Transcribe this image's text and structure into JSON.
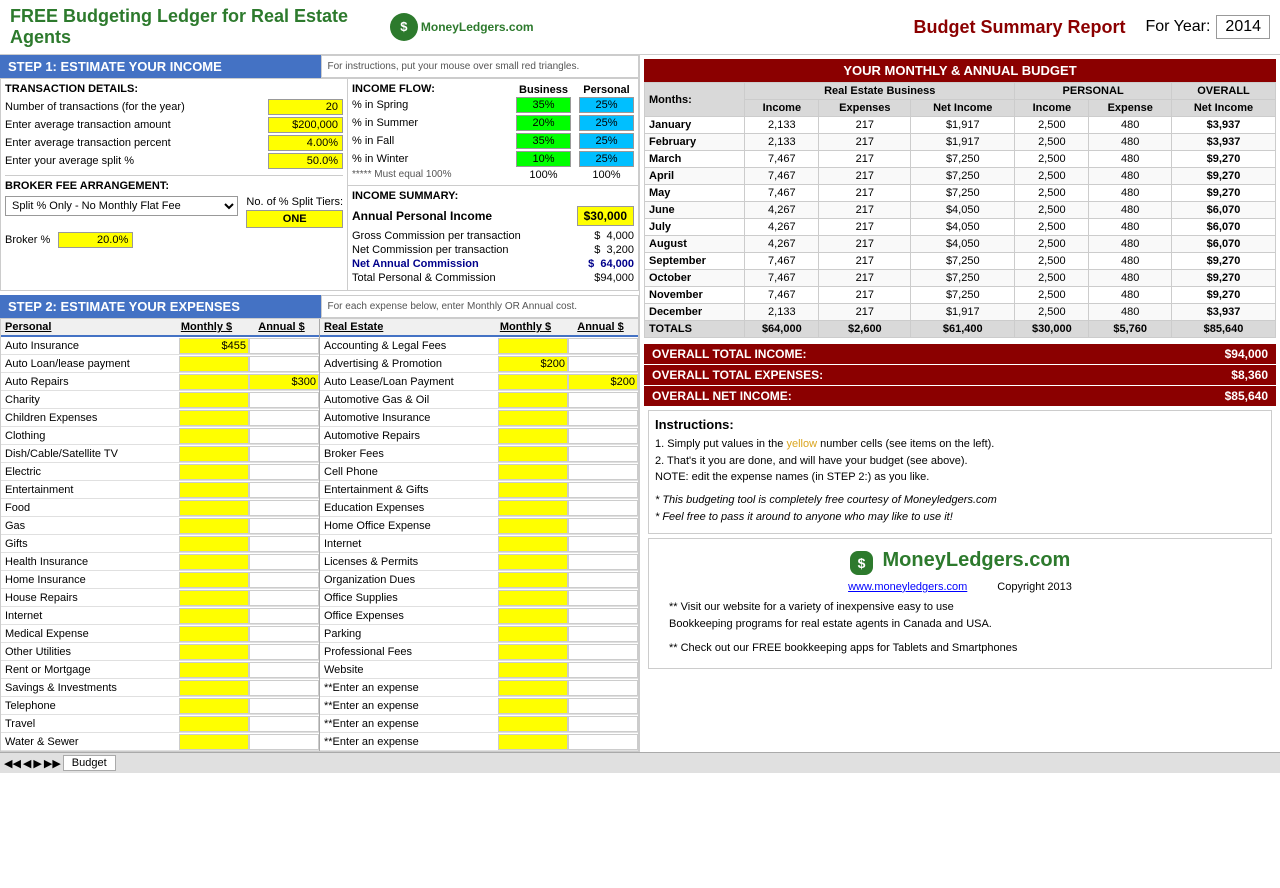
{
  "header": {
    "title": "FREE Budgeting Ledger for Real Estate Agents",
    "logo": "MoneyLedgers.com",
    "budget_summary": "Budget Summary Report",
    "for_year_label": "For Year:",
    "year": "2014"
  },
  "step1": {
    "label": "STEP 1:  ESTIMATE YOUR INCOME",
    "instructions": "For instructions, put your mouse over small red triangles.",
    "transaction_details": {
      "title": "TRANSACTION DETAILS:",
      "rows": [
        {
          "label": "Number of transactions (for the year)",
          "value": "20"
        },
        {
          "label": "Enter average transaction amount",
          "value": "$200,000"
        },
        {
          "label": "Enter average transaction percent",
          "value": "4.00%"
        },
        {
          "label": "Enter your average split %",
          "value": "50.0%"
        }
      ]
    },
    "income_flow": {
      "title": "INCOME FLOW:",
      "headers": [
        "Business",
        "Personal"
      ],
      "rows": [
        {
          "label": "% in Spring",
          "business": "35%",
          "personal": "25%"
        },
        {
          "label": "% in Summer",
          "business": "20%",
          "personal": "25%"
        },
        {
          "label": "% in Fall",
          "business": "35%",
          "personal": "25%"
        },
        {
          "label": "% in Winter",
          "business": "10%",
          "personal": "25%"
        }
      ],
      "must_equal": "***** Must equal 100%",
      "totals": [
        "100%",
        "100%"
      ]
    },
    "broker_fee": {
      "title": "BROKER FEE ARRANGEMENT:",
      "no_of_pct_split_tiers": "No. of % Split Tiers:",
      "dropdown_value": "Split % Only - No Monthly Flat Fee",
      "one_box": "ONE",
      "broker_pct_label": "Broker %",
      "broker_pct_value": "20.0%"
    },
    "income_summary": {
      "title": "INCOME SUMMARY:",
      "annual_personal_label": "Annual Personal Income",
      "annual_personal_value": "$30,000",
      "rows": [
        {
          "label": "Gross Commission per transaction",
          "prefix": "$",
          "value": "4,000"
        },
        {
          "label": "Net Commission per transaction",
          "prefix": "$",
          "value": "3,200"
        },
        {
          "label": "Net Annual Commission",
          "prefix": "$",
          "value": "64,000",
          "bold": true
        },
        {
          "label": "Total Personal & Commission",
          "prefix": "",
          "value": "$94,000"
        }
      ]
    }
  },
  "step2": {
    "label": "STEP 2: ESTIMATE YOUR EXPENSES",
    "instructions": "For each expense below, enter Monthly OR Annual cost.",
    "personal_header": "Personal",
    "monthly_header": "Monthly $",
    "annual_header": "Annual $",
    "real_estate_header": "Real Estate",
    "re_monthly_header": "Monthly $",
    "re_annual_header": "Annual $",
    "personal_expenses": [
      {
        "name": "Auto Insurance",
        "monthly": "$455",
        "annual": ""
      },
      {
        "name": "Auto Loan/lease payment",
        "monthly": "",
        "annual": ""
      },
      {
        "name": "Auto Repairs",
        "monthly": "",
        "annual": "$300"
      },
      {
        "name": "Charity",
        "monthly": "",
        "annual": ""
      },
      {
        "name": "Children Expenses",
        "monthly": "",
        "annual": ""
      },
      {
        "name": "Clothing",
        "monthly": "",
        "annual": ""
      },
      {
        "name": "Dish/Cable/Satellite TV",
        "monthly": "",
        "annual": ""
      },
      {
        "name": "Electric",
        "monthly": "",
        "annual": ""
      },
      {
        "name": "Entertainment",
        "monthly": "",
        "annual": ""
      },
      {
        "name": "Food",
        "monthly": "",
        "annual": ""
      },
      {
        "name": "Gas",
        "monthly": "",
        "annual": ""
      },
      {
        "name": "Gifts",
        "monthly": "",
        "annual": ""
      },
      {
        "name": "Health Insurance",
        "monthly": "",
        "annual": ""
      },
      {
        "name": "Home Insurance",
        "monthly": "",
        "annual": ""
      },
      {
        "name": "House Repairs",
        "monthly": "",
        "annual": ""
      },
      {
        "name": "Internet",
        "monthly": "",
        "annual": ""
      },
      {
        "name": "Medical Expense",
        "monthly": "",
        "annual": ""
      },
      {
        "name": "Other Utilities",
        "monthly": "",
        "annual": ""
      },
      {
        "name": "Rent or Mortgage",
        "monthly": "",
        "annual": ""
      },
      {
        "name": "Savings & Investments",
        "monthly": "",
        "annual": ""
      },
      {
        "name": "Telephone",
        "monthly": "",
        "annual": ""
      },
      {
        "name": "Travel",
        "monthly": "",
        "annual": ""
      },
      {
        "name": "Water & Sewer",
        "monthly": "",
        "annual": ""
      }
    ],
    "real_estate_expenses": [
      {
        "name": "Accounting & Legal Fees",
        "monthly": "",
        "annual": ""
      },
      {
        "name": "Advertising & Promotion",
        "monthly": "$200",
        "annual": ""
      },
      {
        "name": "Auto Lease/Loan Payment",
        "monthly": "",
        "annual": "$200"
      },
      {
        "name": "Automotive Gas & Oil",
        "monthly": "",
        "annual": ""
      },
      {
        "name": "Automotive Insurance",
        "monthly": "",
        "annual": ""
      },
      {
        "name": "Automotive Repairs",
        "monthly": "",
        "annual": ""
      },
      {
        "name": "Broker Fees",
        "monthly": "",
        "annual": ""
      },
      {
        "name": "Cell Phone",
        "monthly": "",
        "annual": ""
      },
      {
        "name": "Entertainment & Gifts",
        "monthly": "",
        "annual": ""
      },
      {
        "name": "Education Expenses",
        "monthly": "",
        "annual": ""
      },
      {
        "name": "Home Office Expense",
        "monthly": "",
        "annual": ""
      },
      {
        "name": "Internet",
        "monthly": "",
        "annual": ""
      },
      {
        "name": "Licenses & Permits",
        "monthly": "",
        "annual": ""
      },
      {
        "name": "Organization Dues",
        "monthly": "",
        "annual": ""
      },
      {
        "name": "Office Supplies",
        "monthly": "",
        "annual": ""
      },
      {
        "name": "Office Expenses",
        "monthly": "",
        "annual": ""
      },
      {
        "name": "Parking",
        "monthly": "",
        "annual": ""
      },
      {
        "name": "Professional Fees",
        "monthly": "",
        "annual": ""
      },
      {
        "name": "Website",
        "monthly": "",
        "annual": ""
      },
      {
        "name": "**Enter an expense",
        "monthly": "",
        "annual": ""
      },
      {
        "name": "**Enter an expense",
        "monthly": "",
        "annual": ""
      },
      {
        "name": "**Enter an expense",
        "monthly": "",
        "annual": ""
      },
      {
        "name": "**Enter an expense",
        "monthly": "",
        "annual": ""
      }
    ]
  },
  "budget_table": {
    "title": "YOUR MONTHLY & ANNUAL BUDGET",
    "col_groups": [
      {
        "label": "Real Estate Business",
        "cols": [
          "Income",
          "Expenses",
          "Net Income"
        ]
      },
      {
        "label": "PERSONAL",
        "cols": [
          "Income",
          "Expense"
        ]
      },
      {
        "label": "OVERALL",
        "cols": [
          "Net Income"
        ]
      }
    ],
    "months_col": "Months:",
    "rows": [
      {
        "month": "January",
        "re_income": "2,133",
        "re_expenses": "217",
        "re_net": "$1,917",
        "p_income": "2,500",
        "p_expense": "480",
        "overall_net": "$3,937"
      },
      {
        "month": "February",
        "re_income": "2,133",
        "re_expenses": "217",
        "re_net": "$1,917",
        "p_income": "2,500",
        "p_expense": "480",
        "overall_net": "$3,937"
      },
      {
        "month": "March",
        "re_income": "7,467",
        "re_expenses": "217",
        "re_net": "$7,250",
        "p_income": "2,500",
        "p_expense": "480",
        "overall_net": "$9,270"
      },
      {
        "month": "April",
        "re_income": "7,467",
        "re_expenses": "217",
        "re_net": "$7,250",
        "p_income": "2,500",
        "p_expense": "480",
        "overall_net": "$9,270"
      },
      {
        "month": "May",
        "re_income": "7,467",
        "re_expenses": "217",
        "re_net": "$7,250",
        "p_income": "2,500",
        "p_expense": "480",
        "overall_net": "$9,270"
      },
      {
        "month": "June",
        "re_income": "4,267",
        "re_expenses": "217",
        "re_net": "$4,050",
        "p_income": "2,500",
        "p_expense": "480",
        "overall_net": "$6,070"
      },
      {
        "month": "July",
        "re_income": "4,267",
        "re_expenses": "217",
        "re_net": "$4,050",
        "p_income": "2,500",
        "p_expense": "480",
        "overall_net": "$6,070"
      },
      {
        "month": "August",
        "re_income": "4,267",
        "re_expenses": "217",
        "re_net": "$4,050",
        "p_income": "2,500",
        "p_expense": "480",
        "overall_net": "$6,070"
      },
      {
        "month": "September",
        "re_income": "7,467",
        "re_expenses": "217",
        "re_net": "$7,250",
        "p_income": "2,500",
        "p_expense": "480",
        "overall_net": "$9,270"
      },
      {
        "month": "October",
        "re_income": "7,467",
        "re_expenses": "217",
        "re_net": "$7,250",
        "p_income": "2,500",
        "p_expense": "480",
        "overall_net": "$9,270"
      },
      {
        "month": "November",
        "re_income": "7,467",
        "re_expenses": "217",
        "re_net": "$7,250",
        "p_income": "2,500",
        "p_expense": "480",
        "overall_net": "$9,270"
      },
      {
        "month": "December",
        "re_income": "2,133",
        "re_expenses": "217",
        "re_net": "$1,917",
        "p_income": "2,500",
        "p_expense": "480",
        "overall_net": "$3,937"
      }
    ],
    "totals": {
      "label": "TOTALS",
      "re_income": "$64,000",
      "re_expenses": "$2,600",
      "re_net": "$61,400",
      "p_income": "$30,000",
      "p_expense": "$5,760",
      "overall_net": "$85,640"
    }
  },
  "overall": {
    "income_label": "OVERALL TOTAL INCOME:",
    "income_value": "$94,000",
    "expenses_label": "OVERALL TOTAL EXPENSES:",
    "expenses_value": "$8,360",
    "net_label": "OVERALL NET INCOME:",
    "net_value": "$85,640"
  },
  "instructions": {
    "title": "Instructions:",
    "line1": "1.  Simply put values in the ",
    "yellow_word": "yellow",
    "line1b": " number cells (see items on the left).",
    "line2": "2.  That's it you are done, and will have your budget (see above).",
    "note": "NOTE: edit the expense names (in STEP 2:) as you like.",
    "italic1": "* This budgeting tool is completely free courtesy of Moneyledgers.com",
    "italic2": "* Feel free to pass it around to anyone who may like to use it!"
  },
  "logo_section": {
    "logo_text": "MoneyLedgers.com",
    "url": "www.moneyledgers.com",
    "copyright": "Copyright 2013",
    "visit1": "** Visit our website for a variety of inexpensive easy to use",
    "visit2": "Bookkeeping programs for real estate agents in Canada and USA.",
    "visit3": "",
    "apps": "** Check out our FREE bookkeeping apps for Tablets and Smartphones"
  },
  "bottom_bar": {
    "sheet_tab": "Budget"
  }
}
